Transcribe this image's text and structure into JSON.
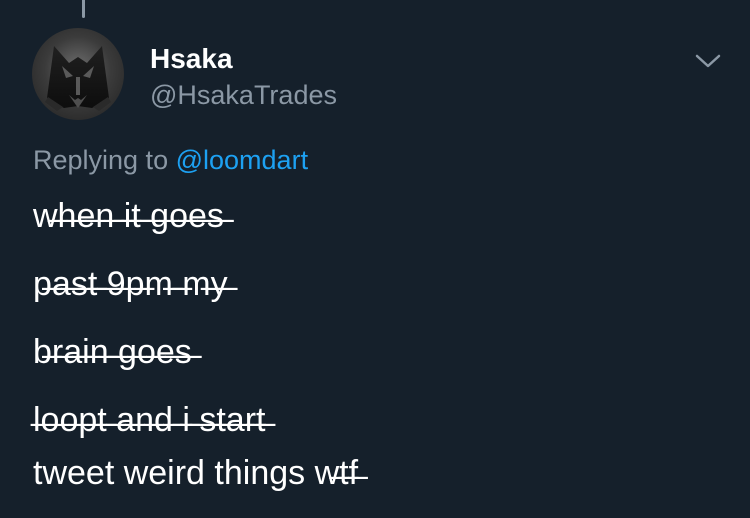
{
  "tweet": {
    "author": {
      "name": "Hsaka",
      "handle": "@HsakaTrades",
      "avatar_icon": "wolf-avatar-icon"
    },
    "menu_icon": "chevron-down-icon",
    "reply": {
      "prefix": "Replying to",
      "mention": "@loomdart"
    },
    "body": {
      "line1": "w̶h̶e̶n̶ ̶i̶t̶ ̶g̶o̶e̶s̶",
      "line2": "p̶a̶s̶t̶ ̶9̶p̶m̶ ̶m̶y̶",
      "line3": "b̶r̶a̶i̶n̶ ̶g̶o̶e̶s̶",
      "line4": "l̶o̶o̶p̶t̶ ̶a̶n̶d̶ ̶i̶ ̶s̶t̶a̶r̶t̶",
      "line5_plain": "tweet weird things",
      "line5_strike": "w̶t̶f̶"
    }
  },
  "colors": {
    "background": "#15202b",
    "text": "#ffffff",
    "secondary_text": "#8b98a5",
    "link": "#1da1f2"
  }
}
